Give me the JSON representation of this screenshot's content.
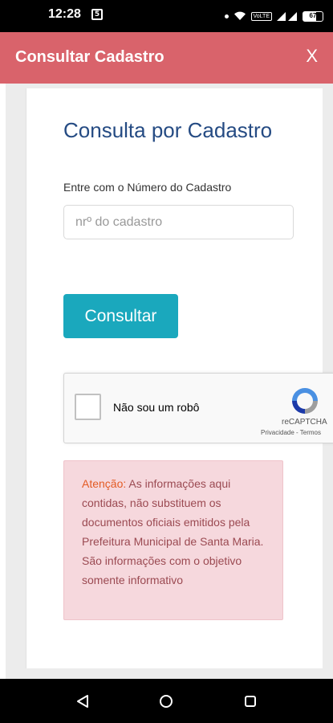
{
  "status_bar": {
    "time": "12:28",
    "notification_icon": "message-icon",
    "network_badge": "VoLTE",
    "battery_level": "67"
  },
  "header": {
    "title": "Consultar Cadastro",
    "close_label": "X",
    "background": "#d9636b"
  },
  "form": {
    "title": "Consulta por Cadastro",
    "field_label": "Entre com o Número do Cadastro",
    "input_placeholder": "nrº do cadastro",
    "input_value": "",
    "submit_label": "Consultar",
    "submit_color": "#1aa8bd"
  },
  "recaptcha": {
    "label": "Não sou um robô",
    "brand": "reCAPTCHA",
    "links": "Privacidade - Termos"
  },
  "alert": {
    "strong": "Atenção:",
    "message": "As informações aqui contidas, não substituem os documentos oficiais emitidos pela Prefeitura Municipal de Santa Maria.",
    "note": "São informações com o objetivo somente informativo"
  },
  "colors": {
    "title_blue": "#254b83",
    "alert_bg": "#f6d8dd",
    "alert_text": "#9b4a52",
    "alert_strong": "#e35b24"
  }
}
